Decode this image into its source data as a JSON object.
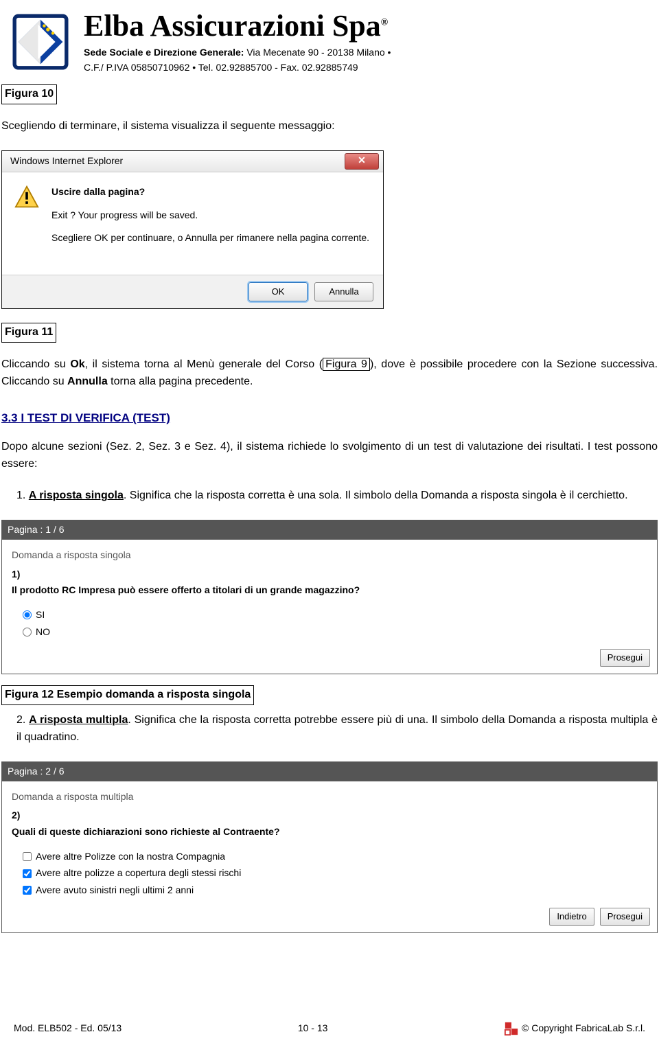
{
  "header": {
    "company": "Elba Assicurazioni Spa",
    "reg": "®",
    "line1_label": "Sede Sociale e Direzione Generale:",
    "line1_value": " Via Mecenate 90 - 20138 Milano •",
    "line2": "C.F./ P.IVA 05850710962 • Tel. 02.92885700 - Fax. 02.92885749"
  },
  "fig10_label": "Figura 10",
  "para_intro": "Scegliendo di terminare, il sistema visualizza il seguente messaggio:",
  "dialog": {
    "title": "Windows Internet Explorer",
    "close": "✕",
    "line1": "Uscire dalla pagina?",
    "line2": "Exit ? Your progress will be saved.",
    "line3": "Scegliere OK per continuare, o Annulla per rimanere nella pagina corrente.",
    "ok": "OK",
    "cancel": "Annulla"
  },
  "fig11_label": "Figura 11",
  "para_after": {
    "pre": "Cliccando su ",
    "ok": "Ok",
    "mid": ", il sistema torna al Menù generale del Corso (",
    "ref": "Figura 9",
    "post": "), dove è possibile procedere con la Sezione successiva. Cliccando su ",
    "ann": "Annulla",
    "end": " torna alla pagina precedente."
  },
  "section_heading": "3.3   I TEST DI VERIFICA (TEST)",
  "para_tests": "Dopo alcune sezioni (Sez. 2, Sez. 3 e Sez. 4), il sistema richiede lo svolgimento di un test di valutazione dei risultati. I test possono essere:",
  "item1": {
    "num": "1. ",
    "label": "A risposta singola",
    "text": ". Significa che la risposta corretta è una sola. Il simbolo della Domanda a risposta singola è il cerchietto."
  },
  "quiz1": {
    "page": "Pagina : 1 / 6",
    "type": "Domanda a risposta singola",
    "num": "1)",
    "question": "Il prodotto RC Impresa può essere offerto a titolari di un grande magazzino?",
    "opt_si": "SI",
    "opt_no": "NO",
    "prosegui": "Prosegui"
  },
  "fig12_label": "Figura 12 Esempio domanda a risposta singola",
  "item2": {
    "num": "2. ",
    "label": "A risposta multipla",
    "text": ". Significa che la risposta corretta potrebbe essere più di una. Il simbolo della Domanda a risposta multipla è il quadratino."
  },
  "quiz2": {
    "page": "Pagina : 2 / 6",
    "type": "Domanda a risposta multipla",
    "num": "2)",
    "question": "Quali di queste dichiarazioni sono richieste al Contraente?",
    "opt1": "Avere altre Polizze con la nostra Compagnia",
    "opt2": "Avere altre polizze a copertura degli stessi rischi",
    "opt3": "Avere avuto sinistri negli ultimi 2 anni",
    "indietro": "Indietro",
    "prosegui": "Prosegui"
  },
  "footer": {
    "left": "Mod. ELB502 - Ed. 05/13",
    "center": "10 - 13",
    "right": "© Copyright FabricaLab S.r.l."
  }
}
